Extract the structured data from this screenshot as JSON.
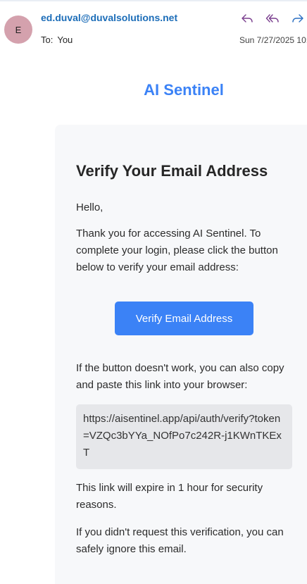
{
  "header": {
    "avatar_initial": "E",
    "sender": "ed.duval@duvalsolutions.net",
    "to_label": "To:",
    "to_value": "You",
    "date": "Sun 7/27/2025 10:",
    "actions": {
      "reply_icon": "reply-icon",
      "reply_all_icon": "reply-all-icon",
      "forward_icon": "forward-icon"
    }
  },
  "email": {
    "brand": "AI Sentinel",
    "heading": "Verify Your Email Address",
    "greeting": "Hello,",
    "intro": "Thank you for accessing AI Sentinel. To complete your login, please click the button below to verify your email address:",
    "button_label": "Verify Email Address",
    "fallback_text": "If the button doesn't work, you can also copy and paste this link into your browser:",
    "verify_link": "https://aisentinel.app/api/auth/verify?token=VZQc3bYYa_NOfPo7c242R-j1KWnTKExT",
    "expire_text": "This link will expire in 1 hour for security reasons.",
    "ignore_text": "If you didn't request this verification, you can safely ignore this email."
  },
  "colors": {
    "accent": "#3b82f6",
    "sender": "#1c6db8",
    "avatar": "#d4a1ad",
    "card": "#f7f8fa",
    "link_box": "#e6e7ea"
  }
}
